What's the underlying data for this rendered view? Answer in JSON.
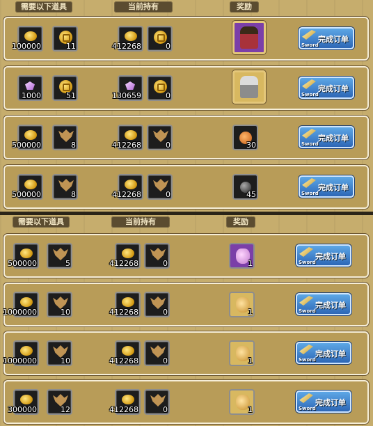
{
  "headers": {
    "required": "需要以下道具",
    "owned": "当前持有",
    "reward": "奖励"
  },
  "button": {
    "label": "完成订单",
    "sub": "Sword"
  },
  "orders_top": [
    {
      "req": [
        {
          "icon": "coin-icon",
          "count": "100000"
        },
        {
          "icon": "gold-token-icon",
          "count": "11"
        }
      ],
      "own": [
        {
          "icon": "coin-icon",
          "count": "412268"
        },
        {
          "icon": "gold-token-icon",
          "count": "0"
        }
      ],
      "reward": {
        "icon": "warrior-character-icon",
        "count": ""
      }
    },
    {
      "req": [
        {
          "icon": "gem-icon",
          "count": "1000"
        },
        {
          "icon": "gold-token-icon",
          "count": "51"
        }
      ],
      "own": [
        {
          "icon": "gem-icon",
          "count": "130659"
        },
        {
          "icon": "gold-token-icon",
          "count": "0"
        }
      ],
      "reward": {
        "icon": "knight-character-icon",
        "count": ""
      }
    },
    {
      "req": [
        {
          "icon": "coin-icon",
          "count": "500000"
        },
        {
          "icon": "bat-emblem-icon",
          "count": "8"
        }
      ],
      "own": [
        {
          "icon": "coin-icon",
          "count": "412268"
        },
        {
          "icon": "bat-emblem-icon",
          "count": "0"
        }
      ],
      "reward": {
        "icon": "potion-icon",
        "count": "30"
      }
    },
    {
      "req": [
        {
          "icon": "coin-icon",
          "count": "500000"
        },
        {
          "icon": "bat-emblem-icon",
          "count": "8"
        }
      ],
      "own": [
        {
          "icon": "coin-icon",
          "count": "412268"
        },
        {
          "icon": "bat-emblem-icon",
          "count": "0"
        }
      ],
      "reward": {
        "icon": "bomb-icon",
        "count": "45"
      }
    }
  ],
  "orders_bottom": [
    {
      "req": [
        {
          "icon": "coin-icon",
          "count": "500000"
        },
        {
          "icon": "bat-emblem-icon",
          "count": "5"
        }
      ],
      "own": [
        {
          "icon": "coin-icon",
          "count": "412268"
        },
        {
          "icon": "bat-emblem-icon",
          "count": "0"
        }
      ],
      "reward": {
        "icon": "pink-bag-icon",
        "count": "1"
      }
    },
    {
      "req": [
        {
          "icon": "coin-icon",
          "count": "1000000"
        },
        {
          "icon": "bat-emblem-icon",
          "count": "10"
        }
      ],
      "own": [
        {
          "icon": "coin-icon",
          "count": "412268"
        },
        {
          "icon": "bat-emblem-icon",
          "count": "0"
        }
      ],
      "reward": {
        "icon": "gold-bag-icon",
        "count": "1"
      }
    },
    {
      "req": [
        {
          "icon": "coin-icon",
          "count": "1000000"
        },
        {
          "icon": "bat-emblem-icon",
          "count": "10"
        }
      ],
      "own": [
        {
          "icon": "coin-icon",
          "count": "412268"
        },
        {
          "icon": "bat-emblem-icon",
          "count": "0"
        }
      ],
      "reward": {
        "icon": "gold-bag-icon",
        "count": "1"
      }
    },
    {
      "req": [
        {
          "icon": "coin-icon",
          "count": "300000"
        },
        {
          "icon": "bat-emblem-icon",
          "count": "12"
        }
      ],
      "own": [
        {
          "icon": "coin-icon",
          "count": "412268"
        },
        {
          "icon": "bat-emblem-icon",
          "count": "0"
        }
      ],
      "reward": {
        "icon": "gold-bag-icon",
        "count": "1"
      }
    }
  ]
}
